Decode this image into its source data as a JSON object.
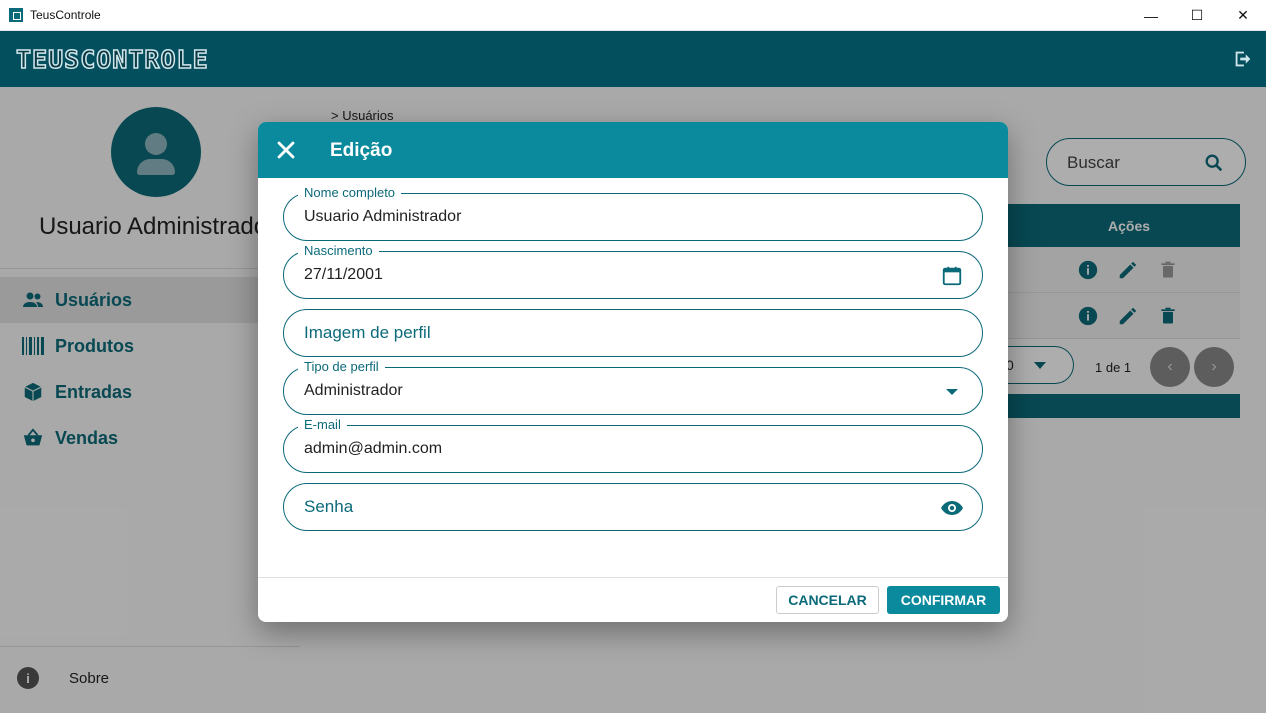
{
  "window": {
    "title": "TeusControle",
    "controls": [
      "—",
      "☐",
      "✕"
    ]
  },
  "appbar": {
    "logo_text": "TEUSCONTROLE",
    "logout_icon": "logout-icon"
  },
  "sidebar": {
    "username": "Usuario Administrador",
    "items": [
      {
        "label": "Usuários",
        "icon": "users-icon",
        "active": true
      },
      {
        "label": "Produtos",
        "icon": "barcode-icon",
        "active": false
      },
      {
        "label": "Entradas",
        "icon": "box-icon",
        "active": false
      },
      {
        "label": "Vendas",
        "icon": "basket-icon",
        "active": false
      }
    ],
    "about_label": "Sobre"
  },
  "main": {
    "breadcrumb": "> Usuários",
    "search_placeholder": "Buscar",
    "table_actions_header": "Ações",
    "pager": {
      "page_size": "0",
      "page_info": "1 de 1"
    }
  },
  "dialog": {
    "title": "Edição",
    "fields": {
      "nome": {
        "label": "Nome completo",
        "value": "Usuario Administrador"
      },
      "nascimento": {
        "label": "Nascimento",
        "value": "27/11/2001"
      },
      "imagem": {
        "placeholder": "Imagem de perfil"
      },
      "tipo": {
        "label": "Tipo de perfil",
        "value": "Administrador"
      },
      "email": {
        "label": "E-mail",
        "value": "admin@admin.com"
      },
      "senha": {
        "placeholder": "Senha"
      }
    },
    "cancel_label": "CANCELAR",
    "confirm_label": "CONFIRMAR"
  },
  "colors": {
    "primary": "#0b8a9d",
    "header": "#034f5e",
    "accent": "#0b6a7a"
  }
}
